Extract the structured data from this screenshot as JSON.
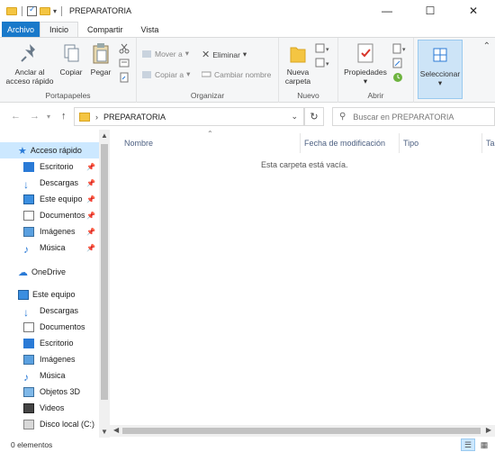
{
  "window": {
    "title": "PREPARATORIA",
    "controls": {
      "minimize": "—",
      "maximize": "☐",
      "close": "✕"
    }
  },
  "ribbon": {
    "tabs": [
      {
        "label": "Archivo"
      },
      {
        "label": "Inicio"
      },
      {
        "label": "Compartir"
      },
      {
        "label": "Vista"
      }
    ],
    "portapapeles": {
      "label": "Portapapeles",
      "pin_label": "Anclar al acceso rápido",
      "copy_label": "Copiar",
      "paste_label": "Pegar"
    },
    "organizar": {
      "label": "Organizar",
      "move_label": "Mover a",
      "copy_to_label": "Copiar a",
      "delete_label": "Eliminar",
      "rename_label": "Cambiar nombre"
    },
    "nuevo": {
      "label": "Nuevo",
      "new_folder_label": "Nueva carpeta"
    },
    "abrir": {
      "label": "Abrir",
      "properties_label": "Propiedades"
    },
    "seleccionar": {
      "label": "Seleccionar"
    }
  },
  "address": {
    "path": "PREPARATORIA",
    "search_placeholder": "Buscar en PREPARATORIA"
  },
  "sidebar": {
    "quick_access": {
      "label": "Acceso rápido",
      "items": [
        {
          "label": "Escritorio",
          "icon": "desktop-icon"
        },
        {
          "label": "Descargas",
          "icon": "download-icon"
        },
        {
          "label": "Este equipo",
          "icon": "computer-icon"
        },
        {
          "label": "Documentos",
          "icon": "documents-icon"
        },
        {
          "label": "Imágenes",
          "icon": "pictures-icon"
        },
        {
          "label": "Música",
          "icon": "music-icon"
        }
      ]
    },
    "onedrive": {
      "label": "OneDrive"
    },
    "this_pc": {
      "label": "Este equipo",
      "items": [
        {
          "label": "Descargas",
          "icon": "download-icon"
        },
        {
          "label": "Documentos",
          "icon": "documents-icon"
        },
        {
          "label": "Escritorio",
          "icon": "desktop-icon"
        },
        {
          "label": "Imágenes",
          "icon": "pictures-icon"
        },
        {
          "label": "Música",
          "icon": "music-icon"
        },
        {
          "label": "Objetos 3D",
          "icon": "3d-objects-icon"
        },
        {
          "label": "Videos",
          "icon": "videos-icon"
        },
        {
          "label": "Disco local (C:)",
          "icon": "drive-icon"
        }
      ]
    }
  },
  "content": {
    "columns": [
      "Nombre",
      "Fecha de modificación",
      "Tipo",
      "Ta"
    ],
    "empty_message": "Esta carpeta está vacía."
  },
  "status": {
    "item_count": "0 elementos"
  },
  "colors": {
    "accent": "#1979ca",
    "selection": "#cce8ff",
    "folder": "#f4c542"
  }
}
